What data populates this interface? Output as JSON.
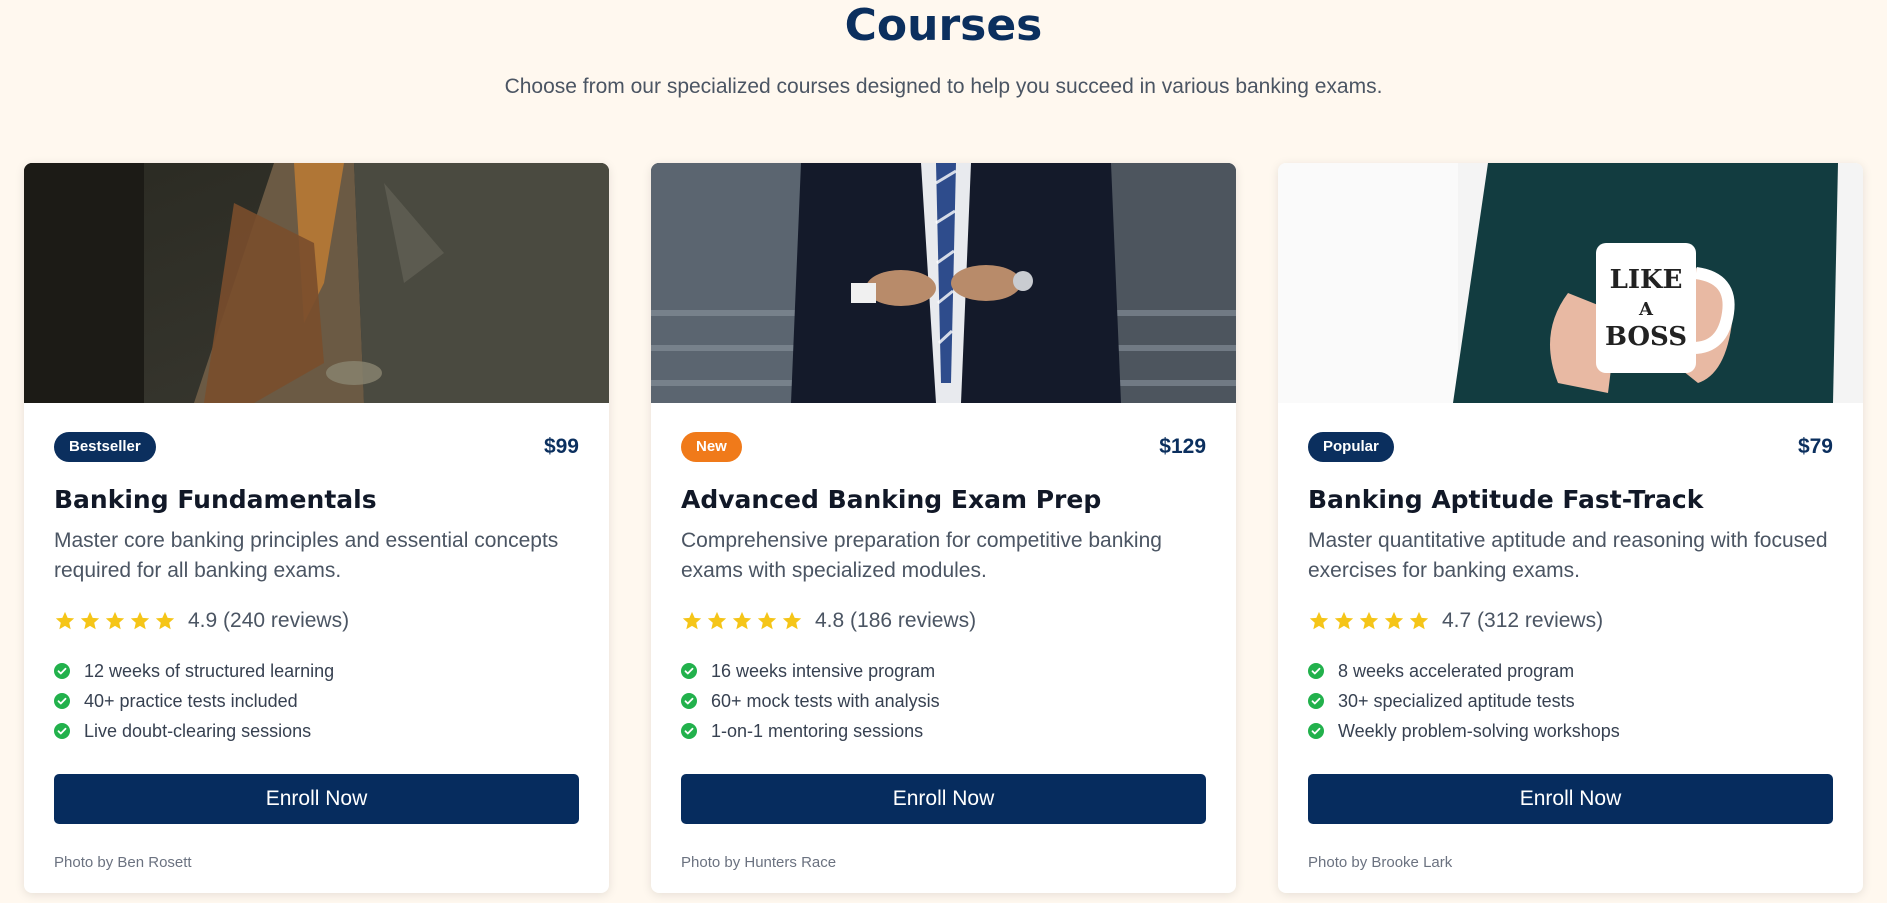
{
  "header": {
    "title": "Courses",
    "subtitle": "Choose from our specialized courses designed to help you succeed in various banking exams."
  },
  "colors": {
    "navy": "#062c5e",
    "orange": "#f07a1a",
    "star": "#f5c518",
    "check": "#22b14c"
  },
  "courses": [
    {
      "badge": "Bestseller",
      "badge_color": "#0b2f5e",
      "price": "$99",
      "title": "Banking Fundamentals",
      "description": "Master core banking principles and essential concepts required for all banking exams.",
      "rating": "4.9 (240 reviews)",
      "stars": 5,
      "features": [
        "12 weeks of structured learning",
        "40+ practice tests included",
        "Live doubt-clearing sessions"
      ],
      "cta": "Enroll Now",
      "credit": "Photo by Ben Rosett"
    },
    {
      "badge": "New",
      "badge_color": "#f07a1a",
      "price": "$129",
      "title": "Advanced Banking Exam Prep",
      "description": "Comprehensive preparation for competitive banking exams with specialized modules.",
      "rating": "4.8 (186 reviews)",
      "stars": 5,
      "features": [
        "16 weeks intensive program",
        "60+ mock tests with analysis",
        "1-on-1 mentoring sessions"
      ],
      "cta": "Enroll Now",
      "credit": "Photo by Hunters Race"
    },
    {
      "badge": "Popular",
      "badge_color": "#0b2f5e",
      "price": "$79",
      "title": "Banking Aptitude Fast-Track",
      "description": "Master quantitative aptitude and reasoning with focused exercises for banking exams.",
      "rating": "4.7 (312 reviews)",
      "stars": 5,
      "features": [
        "8 weeks accelerated program",
        "30+ specialized aptitude tests",
        "Weekly problem-solving workshops"
      ],
      "cta": "Enroll Now",
      "credit": "Photo by Brooke Lark"
    }
  ],
  "mug_text": [
    "LIKE",
    "A",
    "BOSS"
  ]
}
